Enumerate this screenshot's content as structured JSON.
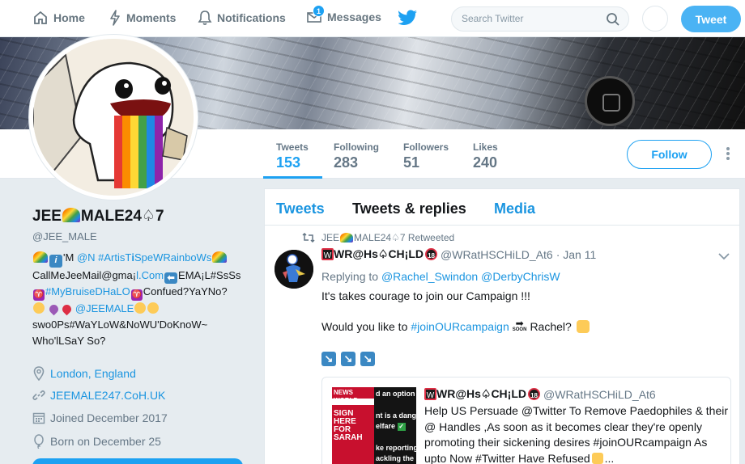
{
  "topnav": {
    "home": "Home",
    "moments": "Moments",
    "notifications": "Notifications",
    "messages": "Messages",
    "messages_badge": "1",
    "search_placeholder": "Search Twitter",
    "tweet_button": "Tweet"
  },
  "profile_nav": {
    "stats": [
      {
        "label": "Tweets",
        "value": "153"
      },
      {
        "label": "Following",
        "value": "283"
      },
      {
        "label": "Followers",
        "value": "51"
      },
      {
        "label": "Likes",
        "value": "240"
      }
    ],
    "follow_button": "Follow"
  },
  "profile": {
    "name_prefix": "JEE",
    "name_suffix": "MALE24",
    "name_end": "7",
    "handle": "@JEE_MALE",
    "bio": {
      "l1_a": "'M ",
      "l1_b": "@N",
      "l1_c": "#ArtisT",
      "l1_d": "SpeWRainboWs",
      "l2_a": "CallMeJeeMail@gma",
      "l2_b": "l.Com",
      "l2_c": "EMA",
      "l2_d": "L#SsSs",
      "l3_a": "#MyBruiseDHaLO",
      "l3_b": "Confued?YaYNo?",
      "l4_a": "@JEEMALE",
      "l5": "swo0Ps#WaYLoW&NoWU'DoKnoW~",
      "l6": "Who'lLSaY So?"
    },
    "location": "London, England",
    "website": "JEEMALE247.CoH.UK",
    "joined": "Joined December 2017",
    "born": "Born on December 25"
  },
  "timeline": {
    "tabs": [
      "Tweets",
      "Tweets & replies",
      "Media"
    ],
    "retweet_by_prefix": "JEE",
    "retweet_by_suffix": "MALE24",
    "retweet_by_end": "7 Retweeted",
    "tweet": {
      "name_a": "WR@Hs",
      "name_b": "CH",
      "name_c": "LD",
      "badge": "18",
      "handle": "@WRatHSCHiLD_At6",
      "date": "· Jan 11",
      "replying_to": "Replying to",
      "reply_user_1": "@Rachel_Swindon",
      "reply_user_2": "@DerbyChrisW",
      "text_1": "It's takes courage to join our Campaign !!!",
      "text_2_a": "Would you like to",
      "text_2_hashtag": "#joinOURcampaign",
      "text_2_soon": "SOON",
      "text_2_b": "Rachel?",
      "arrow_glyph": "↘"
    },
    "quoted": {
      "name_a": "WR@Hs",
      "name_b": "CH",
      "name_c": "LD",
      "badge": "18",
      "handle": "@WRatHSCHiLD_At6",
      "text": "Help US Persuade @Twitter To Remove Paedophiles & their @ Handles ,As soon as it becomes clear they're openly promoting their sickening desires #joinOURcampaign As upto Now #Twitter Have Refused",
      "text_end": "...",
      "img_left_text": "SIGN HERE FOR SARAH",
      "img_left_header": "NEWS WORLD",
      "img_right_lines": [
        "d an option",
        "nt is a dang",
        "elfare",
        "ke reporting",
        "ackling the"
      ]
    }
  },
  "colors": {
    "accent": "#1da1f2",
    "link": "#1b95e0",
    "muted": "#657786",
    "background": "#e6ecf0"
  }
}
